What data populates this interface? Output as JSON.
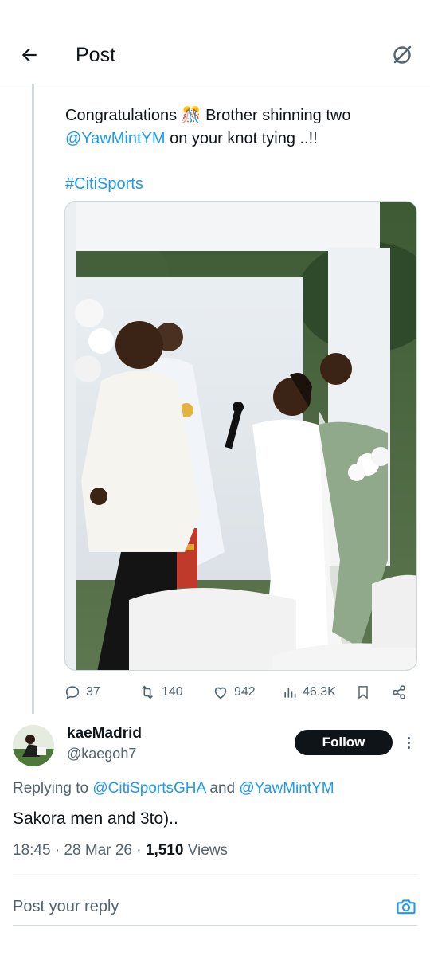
{
  "header": {
    "title": "Post",
    "back_icon": "arrow-left-icon",
    "grok_icon": "grok-icon"
  },
  "tweet": {
    "text_part1": "Congratulations ",
    "emoji": "🎊",
    "text_part2": " Brother shinning two ",
    "mention": "@YawMintYM",
    "text_part3": " on your knot tying ..!!",
    "hashtag": "#CitiSports",
    "stats": {
      "replies": "37",
      "reposts": "140",
      "likes": "942",
      "views": "46.3K"
    }
  },
  "reply": {
    "display_name": "kaeMadrid",
    "handle": "@kaegoh7",
    "follow_label": "Follow",
    "replying_prefix": "Replying to ",
    "replying_mention1": "@CitiSportsGHA",
    "replying_and": " and ",
    "replying_mention2": "@YawMintYM",
    "text": "Sakora men and 3to)..",
    "time": "18:45 · 28 Mar 26 · ",
    "views_count": "1,510",
    "views_label": " Views"
  },
  "composer": {
    "placeholder": "Post your reply",
    "camera_icon": "camera-icon"
  },
  "colors": {
    "accent": "#1d9bf0",
    "text": "#0f1419",
    "secondary": "#536471"
  }
}
